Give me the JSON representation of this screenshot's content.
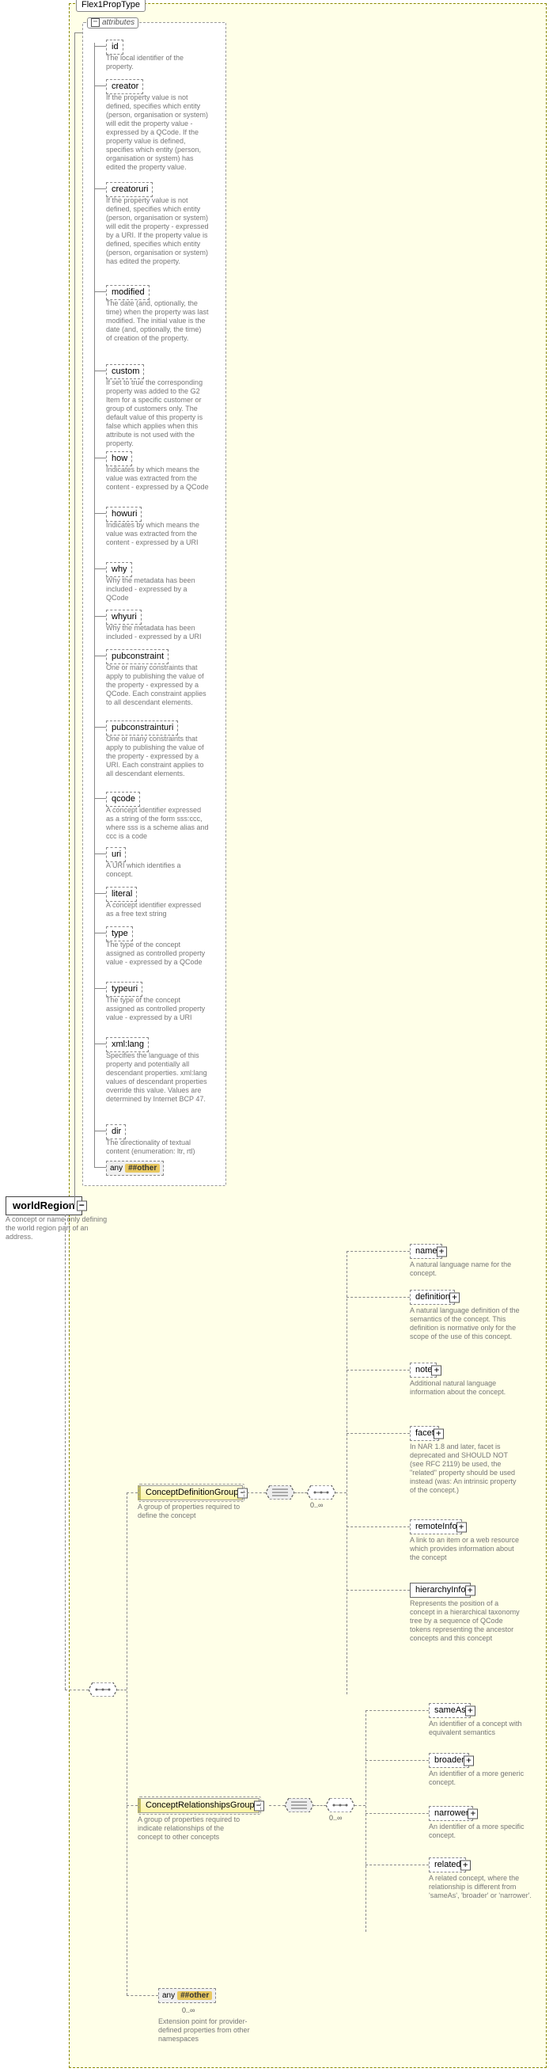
{
  "flex_type_label": "Flex1PropType",
  "attributes_label": "attributes",
  "root": {
    "name": "worldRegion",
    "desc": "A concept or name only defining the world region part of an address."
  },
  "attrs": [
    {
      "key": "id",
      "desc": "The local identifier of the property."
    },
    {
      "key": "creator",
      "desc": "If the property value is not defined, specifies which entity (person, organisation or system) will edit the property value - expressed by a QCode. If the property value is defined, specifies which entity (person, organisation or system) has edited the property value."
    },
    {
      "key": "creatoruri",
      "desc": "If the property value is not defined, specifies which entity (person, organisation or system) will edit the property - expressed by a URI. If the property value is defined, specifies which entity (person, organisation or system) has edited the property."
    },
    {
      "key": "modified",
      "desc": "The date (and, optionally, the time) when the property was last modified. The initial value is the date (and, optionally, the time) of creation of the property."
    },
    {
      "key": "custom",
      "desc": "If set to true the corresponding property was added to the G2 Item for a specific customer or group of customers only. The default value of this property is false which applies when this attribute is not used with the property."
    },
    {
      "key": "how",
      "desc": "Indicates by which means the value was extracted from the content - expressed by a QCode"
    },
    {
      "key": "howuri",
      "desc": "Indicates by which means the value was extracted from the content - expressed by a URI"
    },
    {
      "key": "why",
      "desc": "Why the metadata has been included - expressed by a QCode"
    },
    {
      "key": "whyuri",
      "desc": "Why the metadata has been included - expressed by a URI"
    },
    {
      "key": "pubconstraint",
      "desc": "One or many constraints that apply to publishing the value of the property - expressed by a QCode. Each constraint applies to all descendant elements."
    },
    {
      "key": "pubconstrainturi",
      "desc": "One or many constraints that apply to publishing the value of the property - expressed by a URI. Each constraint applies to all descendant elements."
    },
    {
      "key": "qcode",
      "desc": "A concept identifier expressed as a string of the form sss:ccc, where sss is a scheme alias and ccc is a code"
    },
    {
      "key": "uri",
      "desc": "A URI which identifies a concept."
    },
    {
      "key": "literal",
      "desc": "A concept identifier expressed as a free text string"
    },
    {
      "key": "type",
      "desc": "The type of the concept assigned as controlled property value - expressed by a QCode"
    },
    {
      "key": "typeuri",
      "desc": "The type of the concept assigned as controlled property value - expressed by a URI"
    },
    {
      "key": "xml:lang",
      "desc": "Specifies the language of this property and potentially all descendant properties. xml:lang values of descendant properties override this value. Values are determined by Internet BCP 47."
    },
    {
      "key": "dir",
      "desc": "The directionality of textual content (enumeration: ltr, rtl)"
    }
  ],
  "any_label": "any",
  "any_ns": "##other",
  "groups": {
    "def": {
      "name": "ConceptDefinitionGroup",
      "desc": "A group of properties required to define the concept"
    },
    "rel": {
      "name": "ConceptRelationshipsGroup",
      "desc": "A group of properties required to indicate relationships of the concept to other concepts"
    }
  },
  "def_children": [
    {
      "key": "name",
      "desc": "A natural language name for the concept."
    },
    {
      "key": "definition",
      "desc": "A natural language definition of the semantics of the concept. This definition is normative only for the scope of the use of this concept."
    },
    {
      "key": "note",
      "desc": "Additional natural language information about the concept."
    },
    {
      "key": "facet",
      "desc": "In NAR 1.8 and later, facet is deprecated and SHOULD NOT (see RFC 2119) be used, the \"related\" property should be used instead (was: An intrinsic property of the concept.)"
    },
    {
      "key": "remoteInfo",
      "desc": "A link to an item or a web resource which provides information about the concept"
    },
    {
      "key": "hierarchyInfo",
      "desc": "Represents the position of a concept in a hierarchical taxonomy tree by a sequence of QCode tokens representing the ancestor concepts and this concept"
    }
  ],
  "rel_children": [
    {
      "key": "sameAs",
      "desc": "An identifier of a concept with equivalent semantics"
    },
    {
      "key": "broader",
      "desc": "An identifier of a more generic concept."
    },
    {
      "key": "narrower",
      "desc": "An identifier of a more specific concept."
    },
    {
      "key": "related",
      "desc": "A related concept, where the relationship is different from 'sameAs', 'broader' or 'narrower'."
    }
  ],
  "ext_any_desc": "Extension point for provider-defined properties from other namespaces",
  "cardinality": "0..∞"
}
